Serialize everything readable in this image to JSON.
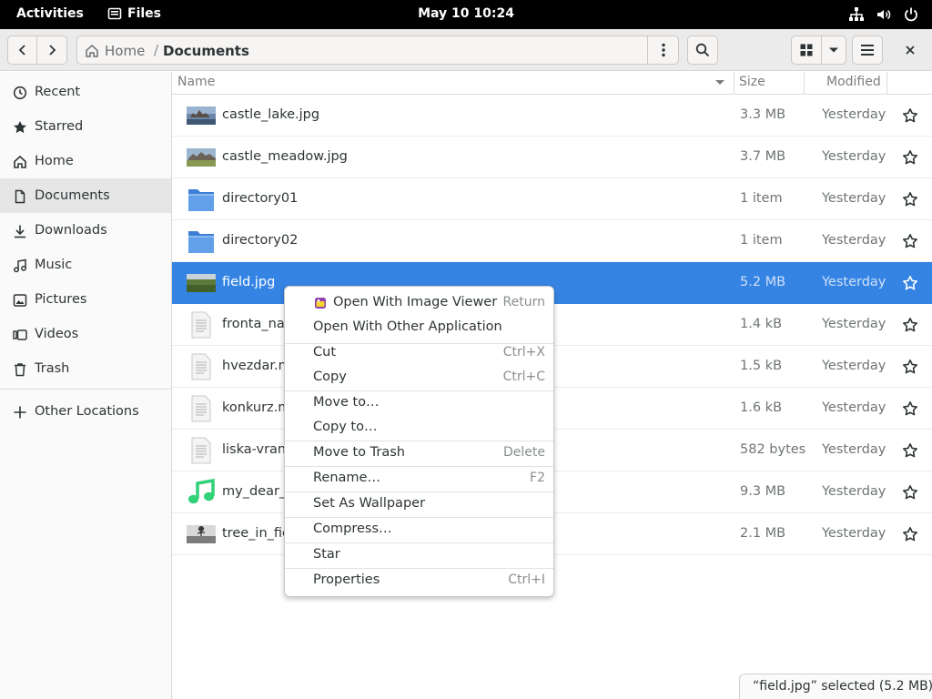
{
  "topbar": {
    "activities": "Activities",
    "app_name": "Files",
    "clock": "May 10  10:24",
    "icons": [
      "network-icon",
      "volume-icon",
      "power-icon"
    ]
  },
  "header": {
    "path": {
      "home": "Home",
      "separator": "/",
      "current": "Documents"
    }
  },
  "sidebar": {
    "items": [
      {
        "label": "Recent",
        "icon": "clock-icon"
      },
      {
        "label": "Starred",
        "icon": "star-icon"
      },
      {
        "label": "Home",
        "icon": "home-icon"
      },
      {
        "label": "Documents",
        "icon": "document-icon",
        "active": true
      },
      {
        "label": "Downloads",
        "icon": "download-icon"
      },
      {
        "label": "Music",
        "icon": "music-icon"
      },
      {
        "label": "Pictures",
        "icon": "pictures-icon"
      },
      {
        "label": "Videos",
        "icon": "video-icon"
      },
      {
        "label": "Trash",
        "icon": "trash-icon"
      },
      {
        "label": "Other Locations",
        "icon": "plus-icon"
      }
    ]
  },
  "columns": {
    "name": "Name",
    "size": "Size",
    "modified": "Modified"
  },
  "files": [
    {
      "name": "castle_lake.jpg",
      "size": "3.3 MB",
      "modified": "Yesterday",
      "kind": "image"
    },
    {
      "name": "castle_meadow.jpg",
      "size": "3.7 MB",
      "modified": "Yesterday",
      "kind": "image"
    },
    {
      "name": "directory01",
      "size": "1 item",
      "modified": "Yesterday",
      "kind": "folder"
    },
    {
      "name": "directory02",
      "size": "1 item",
      "modified": "Yesterday",
      "kind": "folder"
    },
    {
      "name": "field.jpg",
      "size": "5.2 MB",
      "modified": "Yesterday",
      "kind": "image",
      "selected": true
    },
    {
      "name": "fronta_na_",
      "size": "1.4 kB",
      "modified": "Yesterday",
      "kind": "text"
    },
    {
      "name": "hvezdar.m",
      "size": "1.5 kB",
      "modified": "Yesterday",
      "kind": "text"
    },
    {
      "name": "konkurz.m",
      "size": "1.6 kB",
      "modified": "Yesterday",
      "kind": "text"
    },
    {
      "name": "liska-vrana",
      "size": "582 bytes",
      "modified": "Yesterday",
      "kind": "text"
    },
    {
      "name": "my_dear_s",
      "size": "9.3 MB",
      "modified": "Yesterday",
      "kind": "audio"
    },
    {
      "name": "tree_in_fie",
      "size": "2.1 MB",
      "modified": "Yesterday",
      "kind": "image-bw"
    }
  ],
  "context_menu": {
    "items": [
      {
        "label": "Open With Image Viewer",
        "shortcut": "Return",
        "icon": "image-viewer-icon"
      },
      {
        "label": "Open With Other Application",
        "shortcut": ""
      },
      {
        "label": "Cut",
        "shortcut": "Ctrl+X"
      },
      {
        "label": "Copy",
        "shortcut": "Ctrl+C"
      },
      {
        "label": "Move to…",
        "shortcut": ""
      },
      {
        "label": "Copy to…",
        "shortcut": ""
      },
      {
        "label": "Move to Trash",
        "shortcut": "Delete"
      },
      {
        "label": "Rename…",
        "shortcut": "F2"
      },
      {
        "label": "Set As Wallpaper",
        "shortcut": ""
      },
      {
        "label": "Compress…",
        "shortcut": ""
      },
      {
        "label": "Star",
        "shortcut": ""
      },
      {
        "label": "Properties",
        "shortcut": "Ctrl+I"
      }
    ]
  },
  "status": "“field.jpg” selected  (5.2 MB)",
  "colors": {
    "accent": "#3584e4",
    "folder": "#62a0ea",
    "music": "#33d17a"
  }
}
